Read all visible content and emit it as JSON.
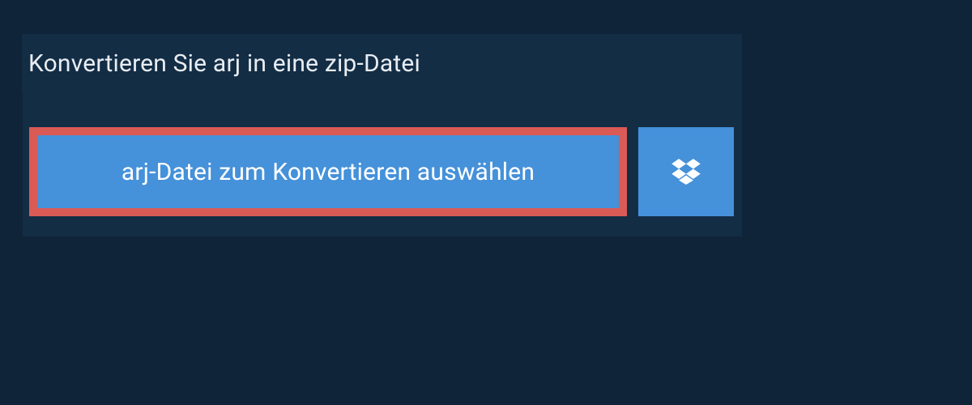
{
  "header": {
    "title": "Konvertieren Sie arj in eine zip-Datei"
  },
  "actions": {
    "select_file_label": "arj-Datei zum Konvertieren auswählen"
  },
  "colors": {
    "page_bg": "#0f2438",
    "panel_bg": "#132d45",
    "button_bg": "#4591da",
    "highlight_border": "#da5a55",
    "text_light": "#e8edf2",
    "text_white": "#ffffff"
  }
}
